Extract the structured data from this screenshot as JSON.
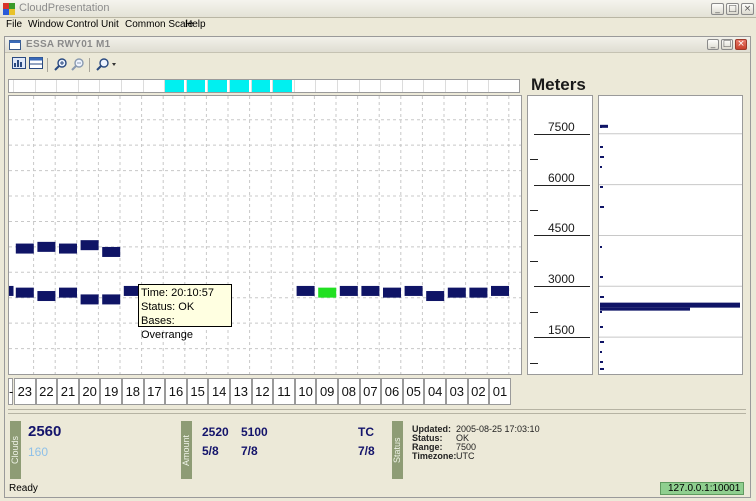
{
  "app": {
    "title": "CloudPresentation",
    "window_buttons": [
      "_",
      "□",
      "×"
    ]
  },
  "menu": [
    "File",
    "Window",
    "Control",
    "Unit",
    "Common Scale",
    "Help"
  ],
  "child": {
    "title": "ESSA RWY01 M1",
    "window_buttons": [
      "_",
      "□",
      "×"
    ]
  },
  "toolbar": {
    "icons": [
      "chart-view-icon",
      "table-view-icon",
      "zoom-in-icon",
      "zoom-out-icon",
      "zoom-dropdown-icon"
    ]
  },
  "colors": {
    "cloud_bar": "#0f1466",
    "status_ok_bar": "#22e022",
    "strip_active": "#00f0f0",
    "connection_ok": "#8fcf8f"
  },
  "scale": {
    "unit": "Meters",
    "labels": [
      "7500",
      "6000",
      "4500",
      "3000",
      "1500"
    ]
  },
  "hours": [
    "-",
    "23",
    "22",
    "21",
    "20",
    "19",
    "18",
    "17",
    "16",
    "15",
    "14",
    "13",
    "12",
    "11",
    "10",
    "09",
    "08",
    "07",
    "06",
    "05",
    "04",
    "03",
    "02",
    "01"
  ],
  "strip_active_hours": [
    "16",
    "15",
    "14",
    "13",
    "12",
    "11"
  ],
  "chart_data": {
    "type": "scatter",
    "x_unit": "hour",
    "y_unit": "Meters",
    "ylim": [
      0,
      8200
    ],
    "upper_layer": [
      {
        "hour": "23",
        "base": 3700
      },
      {
        "hour": "22",
        "base": 3750
      },
      {
        "hour": "21",
        "base": 3700
      },
      {
        "hour": "20",
        "base": 3800
      },
      {
        "hour": "19",
        "base": 3600
      }
    ],
    "lower_layer": [
      {
        "hour": "-",
        "base": 2450
      },
      {
        "hour": "23",
        "base": 2400
      },
      {
        "hour": "22",
        "base": 2300
      },
      {
        "hour": "21",
        "base": 2400
      },
      {
        "hour": "20",
        "base": 2200
      },
      {
        "hour": "19",
        "base": 2200
      },
      {
        "hour": "18",
        "base": 2450
      },
      {
        "hour": "10",
        "base": 2450
      },
      {
        "hour": "09",
        "base": 2400,
        "status": "ok"
      },
      {
        "hour": "08",
        "base": 2450
      },
      {
        "hour": "07",
        "base": 2450
      },
      {
        "hour": "06",
        "base": 2400
      },
      {
        "hour": "05",
        "base": 2450
      },
      {
        "hour": "04",
        "base": 2300
      },
      {
        "hour": "03",
        "base": 2400
      },
      {
        "hour": "02",
        "base": 2400
      },
      {
        "hour": "01",
        "base": 2450
      }
    ]
  },
  "tooltip": {
    "time": "Time: 20:10:57",
    "status": "Status: OK",
    "bases": "Bases: Overrange"
  },
  "clouds": {
    "label": "Clouds",
    "primary": "2560",
    "secondary": "160"
  },
  "amount": {
    "label": "Amount",
    "heights": [
      "2520",
      "5100"
    ],
    "octas": [
      "5/8",
      "7/8"
    ],
    "type_label": "TC",
    "type_octas": "7/8"
  },
  "status": {
    "label": "Status",
    "updated_key": "Updated:",
    "updated_val": "2005-08-25 17:03:10",
    "status_key": "Status:",
    "status_val": "OK",
    "range_key": "Range:",
    "range_val": "7500",
    "tz_key": "Timezone:",
    "tz_val": "UTC"
  },
  "statusbar": {
    "ready": "Ready",
    "connection": "127.0.0.1:10001"
  }
}
